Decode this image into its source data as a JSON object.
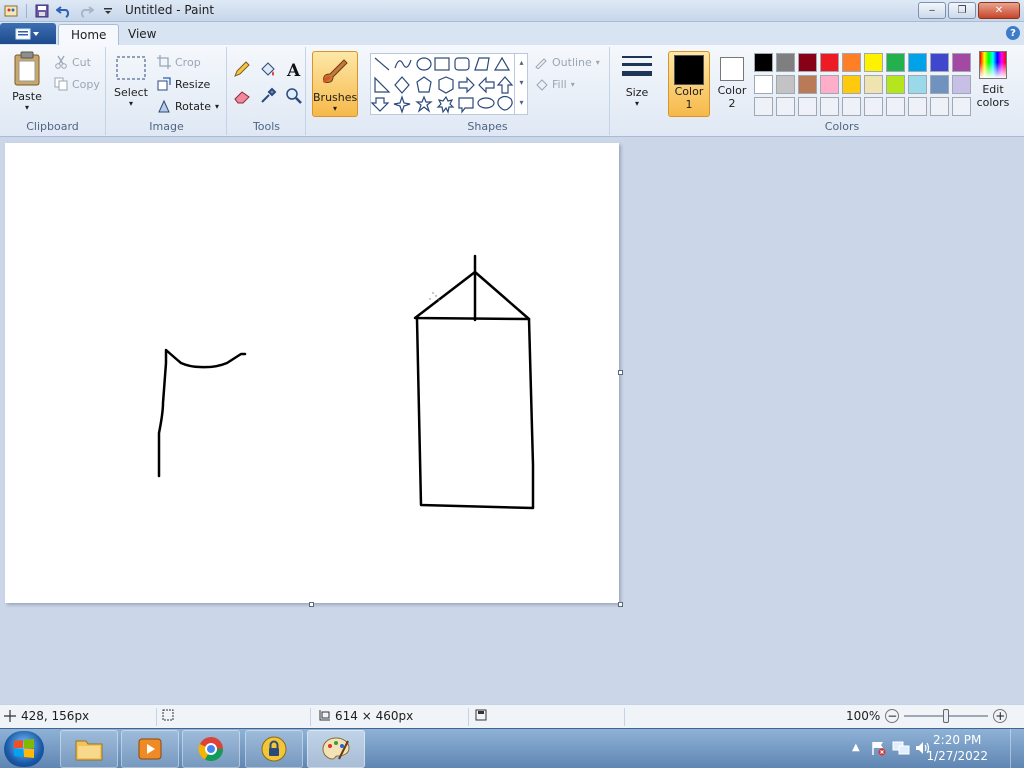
{
  "window": {
    "title": "Untitled - Paint",
    "minimize": "‒",
    "maximize": "❐",
    "close": "✕"
  },
  "tabs": {
    "home": "Home",
    "view": "View",
    "help": "?"
  },
  "ribbon": {
    "clipboard": {
      "label": "Clipboard",
      "paste": "Paste",
      "cut": "Cut",
      "copy": "Copy"
    },
    "image": {
      "label": "Image",
      "select": "Select",
      "crop": "Crop",
      "resize": "Resize",
      "rotate": "Rotate"
    },
    "tools": {
      "label": "Tools"
    },
    "brushes": {
      "label": "Brushes"
    },
    "shapes": {
      "label": "Shapes",
      "outline": "Outline",
      "fill": "Fill"
    },
    "size": {
      "label": "Size"
    },
    "colors": {
      "label": "Colors",
      "color1_line1": "Color",
      "color1_line2": "1",
      "color2_line1": "Color",
      "color2_line2": "2",
      "edit_line1": "Edit",
      "edit_line2": "colors",
      "color1": "#000000",
      "color2": "#ffffff",
      "palette_row1": [
        "#000000",
        "#7f7f7f",
        "#880015",
        "#ed1c24",
        "#ff7f27",
        "#fff200",
        "#22b14c",
        "#00a2e8",
        "#3f48cc",
        "#a349a4"
      ],
      "palette_row2": [
        "#ffffff",
        "#c3c3c3",
        "#b97a57",
        "#ffaec9",
        "#ffc90e",
        "#efe4b0",
        "#b5e61d",
        "#99d9ea",
        "#7092be",
        "#c8bfe7"
      ]
    }
  },
  "status": {
    "cursor_pos": "428, 156px",
    "canvas_size": "614 × 460px",
    "zoom": "100%"
  },
  "taskbar": {
    "time": "2:20 PM",
    "date": "1/27/2022"
  }
}
